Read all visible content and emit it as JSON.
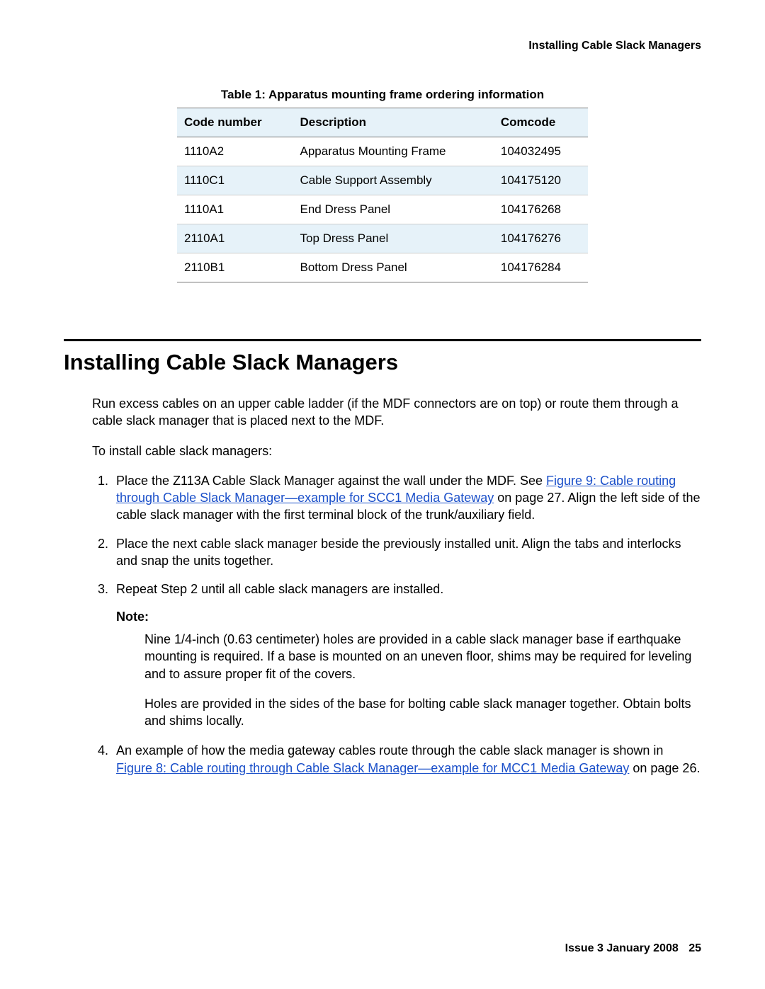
{
  "header": {
    "running_title": "Installing Cable Slack Managers"
  },
  "table1": {
    "caption": "Table 1: Apparatus mounting frame ordering information",
    "columns": [
      "Code number",
      "Description",
      "Comcode"
    ],
    "rows": [
      {
        "code": "1110A2",
        "desc": "Apparatus Mounting Frame",
        "comcode": "104032495"
      },
      {
        "code": "1110C1",
        "desc": "Cable Support Assembly",
        "comcode": "104175120"
      },
      {
        "code": "1110A1",
        "desc": "End Dress Panel",
        "comcode": "104176268"
      },
      {
        "code": "2110A1",
        "desc": "Top Dress Panel",
        "comcode": "104176276"
      },
      {
        "code": "2110B1",
        "desc": "Bottom Dress Panel",
        "comcode": "104176284"
      }
    ]
  },
  "section": {
    "heading": "Installing Cable Slack Managers",
    "intro": "Run excess cables on an upper cable ladder (if the MDF connectors are on top) or route them through a cable slack manager that is placed next to the MDF.",
    "lead_in": "To install cable slack managers:",
    "steps": {
      "s1_pre": "Place the Z113A Cable Slack Manager against the wall under the MDF. See ",
      "s1_link": "Figure 9:  Cable routing through Cable Slack Manager—example for SCC1 Media Gateway",
      "s1_post": " on page 27. Align the left side of the cable slack manager with the first terminal block of the trunk/auxiliary field.",
      "s2": "Place the next cable slack manager beside the previously installed unit. Align the tabs and interlocks and snap the units together.",
      "s3": "Repeat Step 2 until all cable slack managers are installed.",
      "note_label": "Note:",
      "note_p1": "Nine 1/4-inch (0.63 centimeter) holes are provided in a cable slack manager base if earthquake mounting is required. If a base is mounted on an uneven floor, shims may be required for leveling and to assure proper fit of the covers.",
      "note_p2": "Holes are provided in the sides of the base for bolting cable slack manager together. Obtain bolts and shims locally.",
      "s4_pre": "An example of how the media gateway cables route through the cable slack manager is shown in ",
      "s4_link": "Figure 8:  Cable routing through Cable Slack Manager—example for MCC1 Media Gateway",
      "s4_post": " on page 26."
    }
  },
  "footer": {
    "issue": "Issue 3   January 2008",
    "page": "25"
  }
}
